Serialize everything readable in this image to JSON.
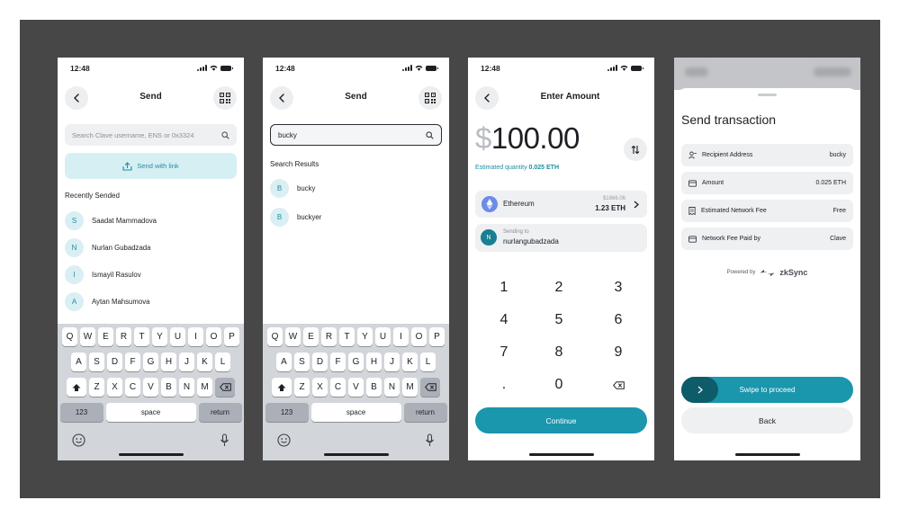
{
  "colors": {
    "accent": "#1a96ad",
    "accent_dark": "#0e5c6a",
    "accent_light": "#d6eff3",
    "frame": "#474747"
  },
  "status": {
    "time": "12:48"
  },
  "send": {
    "title": "Send",
    "search_placeholder": "Search Clave username, ENS or 0x3324",
    "link_label": "Send with link",
    "recent_label": "Recently Sended",
    "contacts": [
      {
        "initial": "S",
        "name": "Saadat Mammadova"
      },
      {
        "initial": "N",
        "name": "Nurlan Gubadzada"
      },
      {
        "initial": "I",
        "name": "Ismayil Rasulov"
      },
      {
        "initial": "A",
        "name": "Aytan Mahsumova"
      }
    ]
  },
  "search": {
    "title": "Send",
    "query": "bucky",
    "results_label": "Search Results",
    "results": [
      {
        "initial": "B",
        "name": "bucky"
      },
      {
        "initial": "B",
        "name": "buckyer"
      }
    ]
  },
  "keyboard": {
    "row1": [
      "Q",
      "W",
      "E",
      "R",
      "T",
      "Y",
      "U",
      "I",
      "O",
      "P"
    ],
    "row2": [
      "A",
      "S",
      "D",
      "F",
      "G",
      "H",
      "J",
      "K",
      "L"
    ],
    "row3": [
      "Z",
      "X",
      "C",
      "V",
      "B",
      "N",
      "M"
    ],
    "numbers": "123",
    "space": "space",
    "return": "return"
  },
  "amount": {
    "title": "Enter Amount",
    "currency": "$",
    "value": "100.00",
    "estimate_label": "Estimated quantity",
    "estimate_value": "0.025 ETH",
    "asset_name": "Ethereum",
    "asset_fiat": "$1866.06",
    "asset_balance": "1.23 ETH",
    "sending_label": "Sending to",
    "recipient": "nurlangubadzada",
    "keys": [
      "1",
      "2",
      "3",
      "4",
      "5",
      "6",
      "7",
      "8",
      "9",
      ".",
      "0"
    ],
    "continue": "Continue"
  },
  "confirm": {
    "title": "Send transaction",
    "rows": [
      {
        "icon": "user-icon",
        "label": "Recipient Address",
        "value": "bucky"
      },
      {
        "icon": "card-icon",
        "label": "Amount",
        "value": "0.025 ETH"
      },
      {
        "icon": "receipt-icon",
        "label": "Estimated Network Fee",
        "value": "Free"
      },
      {
        "icon": "card-icon",
        "label": "Network Fee Paid by",
        "value": "Clave"
      }
    ],
    "powered_by": "Powered by",
    "brand": "zkSync",
    "swipe": "Swipe to proceed",
    "back": "Back"
  }
}
